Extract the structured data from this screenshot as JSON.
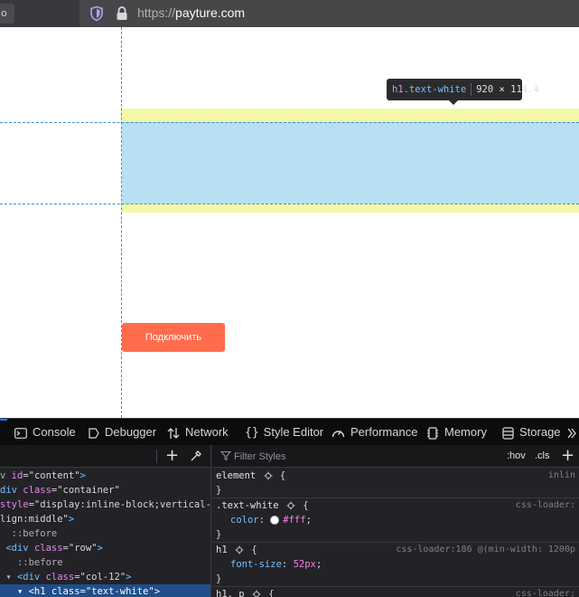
{
  "browser": {
    "url_scheme": "https://",
    "url_host": "payture.com"
  },
  "page": {
    "tooltip": {
      "tag": "h1",
      "class": ".text-white",
      "dimensions": "920 × 114.4"
    },
    "cta_label": "Подключить"
  },
  "devtools": {
    "tabs": [
      "Console",
      "Debugger",
      "Network",
      "Style Editor",
      "Performance",
      "Memory",
      "Storage"
    ],
    "markup": {
      "lines": [
        {
          "pre": "v ",
          "tag": "id",
          "eq": "=\"content\">"
        },
        {
          "text": "div class=\"container\""
        },
        {
          "text": "style=\"display:inline-block;vertical-"
        },
        {
          "text": "lign:middle\">"
        },
        {
          "text": " ::before"
        },
        {
          "text": " <div class=\"row\">"
        },
        {
          "text": "  ::before"
        },
        {
          "text": " <div class=\"col-12\">"
        },
        {
          "text": "  <h1 class=\"text-white\">"
        }
      ]
    },
    "rules": {
      "filter_placeholder": "Filter Styles",
      "hov": ":hov",
      "cls": ".cls",
      "items": [
        {
          "selector": "element",
          "open": "{",
          "close": "}",
          "source": "inlin"
        },
        {
          "selector": ".text-white",
          "open": "{",
          "prop": "color",
          "value": "#fff",
          "close": "}",
          "source": "css-loader:"
        },
        {
          "selector": "h1",
          "open": "{",
          "prop": "font-size",
          "value": "52px",
          "close": "}",
          "source": "css-loader:186 @(min-width: 1200p"
        },
        {
          "selector": "h1, p",
          "open": "{",
          "source": "css-loader:"
        }
      ]
    }
  },
  "colors": {
    "accent": "#0a84ff",
    "cta": "#ff6c4c",
    "margin_highlight": "#f3f7a6",
    "content_highlight": "#b7e0f2"
  }
}
